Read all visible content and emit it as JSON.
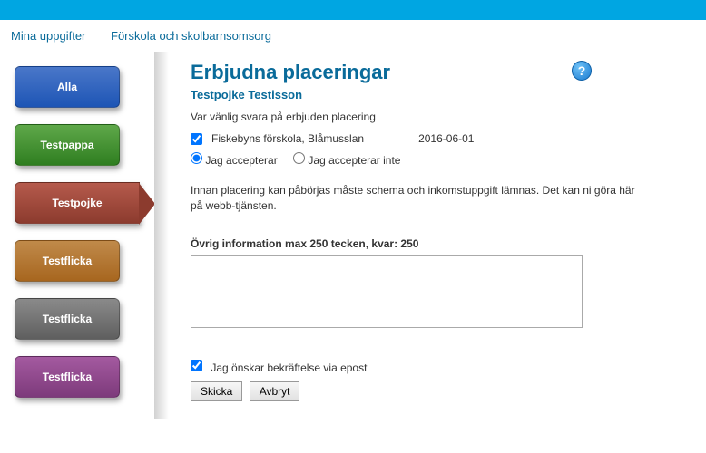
{
  "topnav": {
    "item1": "Mina uppgifter",
    "item2": "Förskola och skolbarnsomsorg"
  },
  "sidebar": {
    "items": [
      {
        "label": "Alla"
      },
      {
        "label": "Testpappa"
      },
      {
        "label": "Testpojke"
      },
      {
        "label": "Testflicka"
      },
      {
        "label": "Testflicka"
      },
      {
        "label": "Testflicka"
      }
    ]
  },
  "page": {
    "title": "Erbjudna placeringar",
    "help_symbol": "?",
    "subtitle": "Testpojke Testisson",
    "instruction": "Var vänlig svara på erbjuden placering",
    "offer": {
      "checked": true,
      "name": "Fiskebyns förskola, Blåmusslan",
      "date": "2016-06-01"
    },
    "accept": {
      "yes_label": "Jag accepterar",
      "no_label": "Jag accepterar inte",
      "selected": "yes"
    },
    "note": "Innan placering kan påbörjas måste schema och inkomstuppgift lämnas. Det kan ni göra här på webb-tjänsten.",
    "info_label": "Övrig information max 250 tecken, kvar: 250",
    "info_value": "",
    "confirm": {
      "checked": true,
      "label": "Jag önskar bekräftelse via epost"
    },
    "buttons": {
      "send": "Skicka",
      "cancel": "Avbryt"
    }
  }
}
